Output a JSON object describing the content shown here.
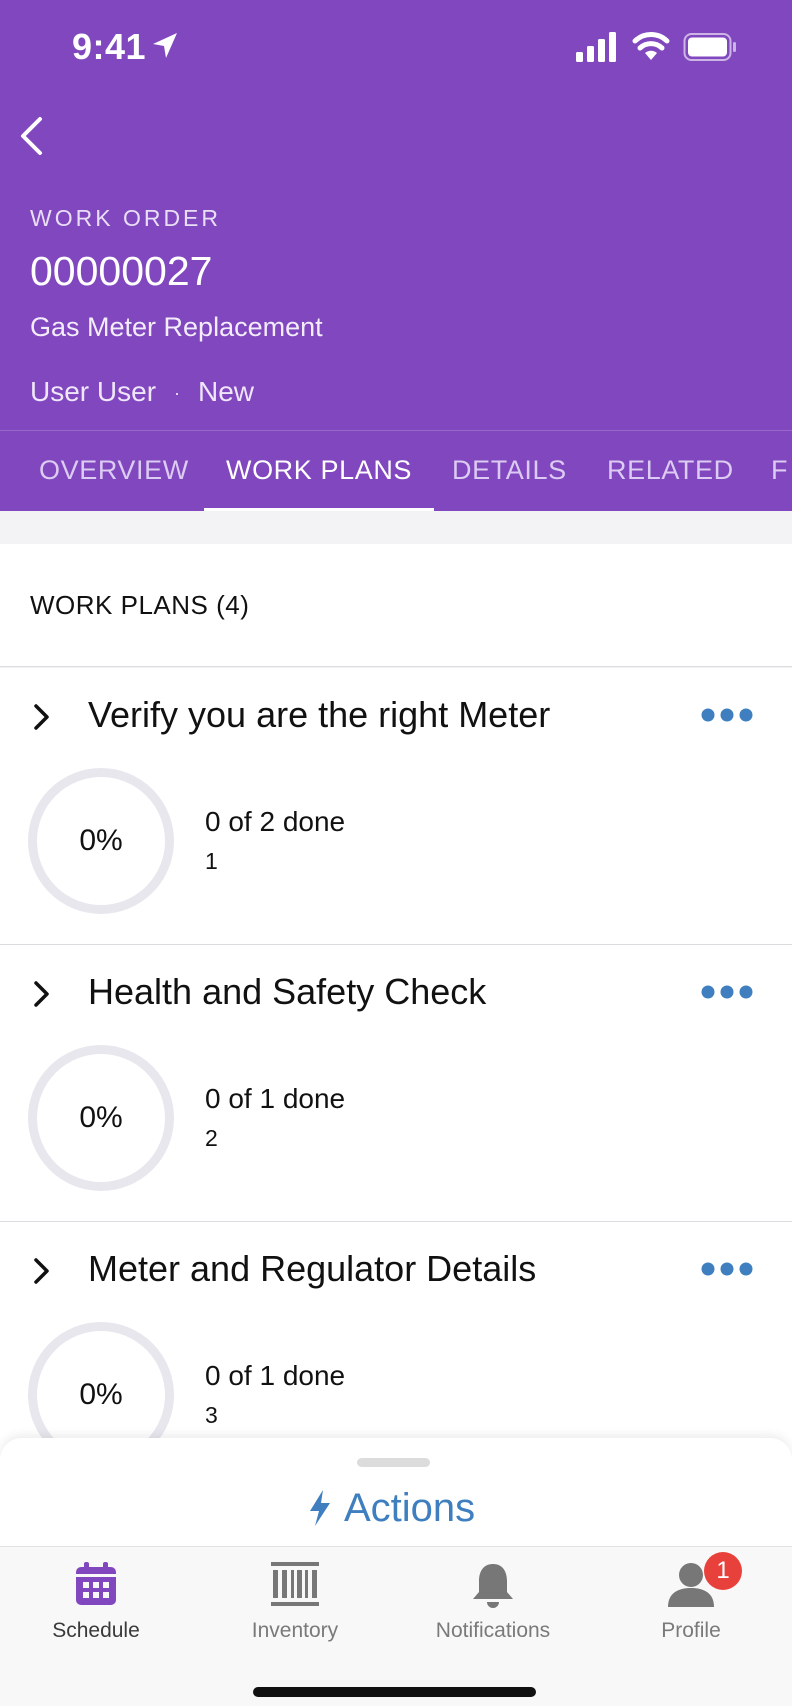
{
  "status_bar": {
    "time": "9:41"
  },
  "header": {
    "eyebrow": "WORK ORDER",
    "number": "00000027",
    "subject": "Gas Meter Replacement",
    "owner": "User User",
    "separator": "·",
    "status": "New",
    "background_color": "#8147be"
  },
  "tabs": [
    {
      "label": "OVERVIEW"
    },
    {
      "label": "WORK PLANS"
    },
    {
      "label": "DETAILS"
    },
    {
      "label": "RELATED"
    },
    {
      "label": "F"
    }
  ],
  "active_tab": "WORK PLANS",
  "section": {
    "title": "WORK PLANS (4)"
  },
  "work_plans": [
    {
      "title": "Verify you are the right Meter",
      "progress": "0%",
      "progress_fraction": 0,
      "done": "0 of 2 done",
      "order": "1"
    },
    {
      "title": "Health and Safety Check",
      "progress": "0%",
      "progress_fraction": 0,
      "done": "0 of 1 done",
      "order": "2"
    },
    {
      "title": "Meter and Regulator Details",
      "progress": "0%",
      "progress_fraction": 0,
      "done": "0 of 1 done",
      "order": "3"
    }
  ],
  "actions": {
    "label": "Actions",
    "icon": "bolt-icon",
    "color": "#3f7fbf"
  },
  "tab_bar": {
    "items": [
      {
        "label": "Schedule",
        "icon": "calendar-icon"
      },
      {
        "label": "Inventory",
        "icon": "barcode-icon"
      },
      {
        "label": "Notifications",
        "icon": "bell-icon"
      },
      {
        "label": "Profile",
        "icon": "person-icon"
      }
    ],
    "profile_badge": "1",
    "active": "Schedule",
    "active_color": "#8147be"
  }
}
